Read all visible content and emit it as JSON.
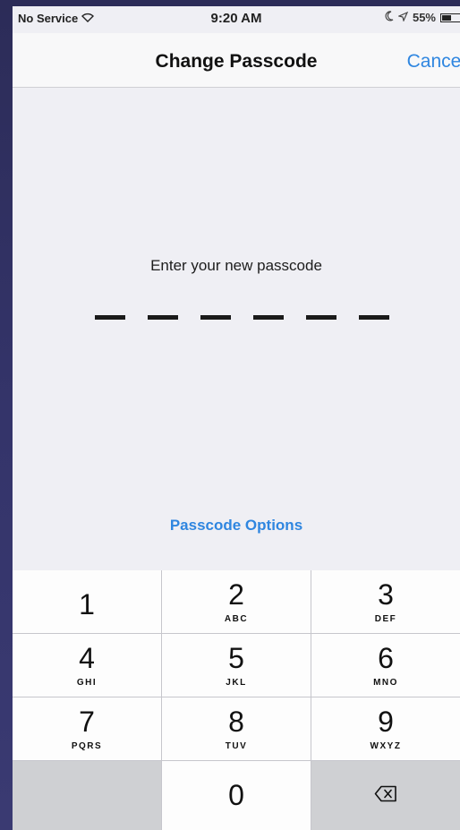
{
  "status_bar": {
    "carrier": "No Service",
    "time": "9:20 AM",
    "battery": "55%",
    "battery_level": 0.55,
    "icons": [
      "wifi-icon",
      "moon-icon",
      "location-icon",
      "battery-icon"
    ]
  },
  "nav": {
    "title": "Change Passcode",
    "cancel_label": "Cancel"
  },
  "main": {
    "prompt": "Enter your new passcode",
    "passcode_length": 6,
    "options_label": "Passcode Options"
  },
  "keypad": {
    "keys": [
      {
        "digit": "1",
        "letters": ""
      },
      {
        "digit": "2",
        "letters": "ABC"
      },
      {
        "digit": "3",
        "letters": "DEF"
      },
      {
        "digit": "4",
        "letters": "GHI"
      },
      {
        "digit": "5",
        "letters": "JKL"
      },
      {
        "digit": "6",
        "letters": "MNO"
      },
      {
        "digit": "7",
        "letters": "PQRS"
      },
      {
        "digit": "8",
        "letters": "TUV"
      },
      {
        "digit": "9",
        "letters": "WXYZ"
      },
      {
        "digit": "0",
        "letters": ""
      }
    ],
    "delete_icon": "backspace-icon"
  },
  "colors": {
    "accent": "#2f86e0",
    "background": "#efeff4",
    "keypad_background": "#c6c6cc",
    "key": "#fdfdfd",
    "key_dark": "#cfd0d3"
  }
}
